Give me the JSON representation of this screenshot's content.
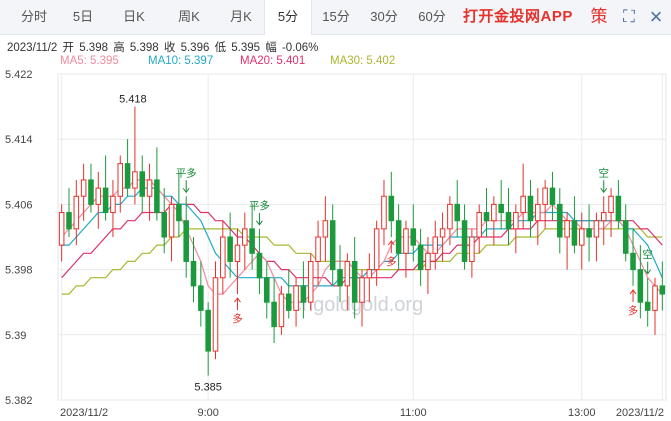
{
  "tabs": [
    {
      "label": "分时"
    },
    {
      "label": "5日"
    },
    {
      "label": "日K"
    },
    {
      "label": "周K"
    },
    {
      "label": "月K"
    },
    {
      "label": "5分"
    },
    {
      "label": "15分"
    },
    {
      "label": "30分"
    },
    {
      "label": "60分"
    }
  ],
  "active_tab": "5分",
  "brand": "打开金投网APP",
  "toolbar": {
    "strategy": "策",
    "fullscreen": "⛶",
    "close": "×"
  },
  "info": {
    "date": "2023/11/2",
    "open_label": "开",
    "open": "5.398",
    "high_label": "高",
    "high": "5.398",
    "close_label": "收",
    "close": "5.396",
    "low_label": "低",
    "low": "5.395",
    "change_label": "幅",
    "change": "-0.06%"
  },
  "ma": [
    {
      "label": "MA5: 5.395",
      "color": "#f08aa0"
    },
    {
      "label": "MA10: 5.397",
      "color": "#22a9c8"
    },
    {
      "label": "MA20: 5.401",
      "color": "#e0306a"
    },
    {
      "label": "MA30: 5.402",
      "color": "#a8b830"
    }
  ],
  "watermark": "cngoldgold.org",
  "colors": {
    "up": "#e5322d",
    "down": "#1a9a3c",
    "signal": "#1a8a3a"
  },
  "chart_data": {
    "type": "candlestick",
    "ylim": [
      5.382,
      5.422
    ],
    "yticks": [
      "5.422",
      "5.414",
      "5.406",
      "5.398",
      "5.39",
      "5.382"
    ],
    "xticks": [
      "2023/11/2",
      "9:00",
      "11:00",
      "13:00",
      "2023/11/2"
    ],
    "extremes": {
      "high": "5.418",
      "low": "5.385"
    },
    "signals": [
      {
        "label": "平多",
        "index": 17,
        "type": "close-long"
      },
      {
        "label": "平多",
        "index": 27,
        "type": "close-long"
      },
      {
        "label": "多",
        "index": 24,
        "type": "long"
      },
      {
        "label": "多",
        "index": 45,
        "type": "long"
      },
      {
        "label": "多",
        "index": 78,
        "type": "long"
      },
      {
        "label": "空",
        "index": 74,
        "type": "short"
      },
      {
        "label": "空",
        "index": 80,
        "type": "short"
      }
    ],
    "ohlc": [
      [
        5.401,
        5.406,
        5.399,
        5.405
      ],
      [
        5.405,
        5.408,
        5.402,
        5.403
      ],
      [
        5.403,
        5.409,
        5.401,
        5.407
      ],
      [
        5.407,
        5.411,
        5.404,
        5.409
      ],
      [
        5.409,
        5.411,
        5.405,
        5.406
      ],
      [
        5.406,
        5.41,
        5.403,
        5.408
      ],
      [
        5.408,
        5.412,
        5.404,
        5.405
      ],
      [
        5.405,
        5.409,
        5.402,
        5.407
      ],
      [
        5.407,
        5.412,
        5.405,
        5.411
      ],
      [
        5.411,
        5.414,
        5.407,
        5.408
      ],
      [
        5.408,
        5.418,
        5.406,
        5.41
      ],
      [
        5.41,
        5.412,
        5.405,
        5.407
      ],
      [
        5.407,
        5.411,
        5.404,
        5.409
      ],
      [
        5.409,
        5.413,
        5.404,
        5.405
      ],
      [
        5.405,
        5.408,
        5.4,
        5.402
      ],
      [
        5.402,
        5.407,
        5.399,
        5.406
      ],
      [
        5.406,
        5.41,
        5.402,
        5.404
      ],
      [
        5.404,
        5.407,
        5.397,
        5.399
      ],
      [
        5.399,
        5.402,
        5.394,
        5.396
      ],
      [
        5.396,
        5.399,
        5.391,
        5.393
      ],
      [
        5.393,
        5.394,
        5.385,
        5.388
      ],
      [
        5.388,
        5.399,
        5.387,
        5.397
      ],
      [
        5.397,
        5.404,
        5.395,
        5.402
      ],
      [
        5.402,
        5.405,
        5.397,
        5.399
      ],
      [
        5.399,
        5.403,
        5.395,
        5.401
      ],
      [
        5.401,
        5.405,
        5.398,
        5.403
      ],
      [
        5.403,
        5.406,
        5.398,
        5.4
      ],
      [
        5.4,
        5.403,
        5.395,
        5.397
      ],
      [
        5.397,
        5.399,
        5.392,
        5.394
      ],
      [
        5.394,
        5.397,
        5.389,
        5.391
      ],
      [
        5.391,
        5.396,
        5.39,
        5.395
      ],
      [
        5.395,
        5.398,
        5.392,
        5.393
      ],
      [
        5.393,
        5.397,
        5.391,
        5.396
      ],
      [
        5.396,
        5.399,
        5.392,
        5.394
      ],
      [
        5.394,
        5.4,
        5.393,
        5.399
      ],
      [
        5.399,
        5.404,
        5.396,
        5.402
      ],
      [
        5.402,
        5.407,
        5.399,
        5.404
      ],
      [
        5.404,
        5.406,
        5.396,
        5.398
      ],
      [
        5.398,
        5.401,
        5.394,
        5.396
      ],
      [
        5.396,
        5.4,
        5.393,
        5.399
      ],
      [
        5.399,
        5.402,
        5.392,
        5.394
      ],
      [
        5.394,
        5.398,
        5.391,
        5.397
      ],
      [
        5.397,
        5.4,
        5.394,
        5.398
      ],
      [
        5.398,
        5.404,
        5.396,
        5.403
      ],
      [
        5.403,
        5.409,
        5.401,
        5.407
      ],
      [
        5.407,
        5.41,
        5.402,
        5.404
      ],
      [
        5.404,
        5.406,
        5.398,
        5.4
      ],
      [
        5.4,
        5.404,
        5.397,
        5.403
      ],
      [
        5.403,
        5.406,
        5.399,
        5.401
      ],
      [
        5.401,
        5.403,
        5.396,
        5.398
      ],
      [
        5.398,
        5.402,
        5.395,
        5.4
      ],
      [
        5.4,
        5.404,
        5.398,
        5.402
      ],
      [
        5.402,
        5.405,
        5.399,
        5.403
      ],
      [
        5.403,
        5.407,
        5.401,
        5.406
      ],
      [
        5.406,
        5.409,
        5.402,
        5.404
      ],
      [
        5.404,
        5.406,
        5.398,
        5.399
      ],
      [
        5.399,
        5.403,
        5.397,
        5.402
      ],
      [
        5.402,
        5.406,
        5.4,
        5.405
      ],
      [
        5.405,
        5.408,
        5.402,
        5.404
      ],
      [
        5.404,
        5.407,
        5.401,
        5.406
      ],
      [
        5.406,
        5.409,
        5.403,
        5.405
      ],
      [
        5.405,
        5.408,
        5.401,
        5.403
      ],
      [
        5.403,
        5.406,
        5.4,
        5.405
      ],
      [
        5.405,
        5.411,
        5.403,
        5.407
      ],
      [
        5.407,
        5.409,
        5.402,
        5.404
      ],
      [
        5.404,
        5.408,
        5.401,
        5.406
      ],
      [
        5.406,
        5.409,
        5.403,
        5.408
      ],
      [
        5.408,
        5.41,
        5.404,
        5.406
      ],
      [
        5.406,
        5.408,
        5.4,
        5.402
      ],
      [
        5.402,
        5.405,
        5.398,
        5.404
      ],
      [
        5.404,
        5.407,
        5.4,
        5.401
      ],
      [
        5.401,
        5.405,
        5.398,
        5.403
      ],
      [
        5.403,
        5.406,
        5.399,
        5.402
      ],
      [
        5.402,
        5.405,
        5.399,
        5.404
      ],
      [
        5.404,
        5.407,
        5.401,
        5.405
      ],
      [
        5.405,
        5.408,
        5.402,
        5.407
      ],
      [
        5.407,
        5.409,
        5.403,
        5.404
      ],
      [
        5.404,
        5.406,
        5.399,
        5.4
      ],
      [
        5.4,
        5.403,
        5.396,
        5.398
      ],
      [
        5.398,
        5.401,
        5.392,
        5.394
      ],
      [
        5.394,
        5.397,
        5.391,
        5.393
      ],
      [
        5.393,
        5.397,
        5.39,
        5.396
      ],
      [
        5.396,
        5.399,
        5.393,
        5.395
      ]
    ],
    "ma5": [
      5.402,
      5.403,
      5.404,
      5.405,
      5.406,
      5.407,
      5.407,
      5.407,
      5.408,
      5.408,
      5.409,
      5.409,
      5.409,
      5.408,
      5.407,
      5.406,
      5.405,
      5.403,
      5.401,
      5.399,
      5.396,
      5.395,
      5.395,
      5.396,
      5.397,
      5.398,
      5.399,
      5.4,
      5.399,
      5.397,
      5.395,
      5.394,
      5.394,
      5.394,
      5.395,
      5.396,
      5.398,
      5.399,
      5.399,
      5.399,
      5.398,
      5.397,
      5.397,
      5.398,
      5.399,
      5.401,
      5.402,
      5.402,
      5.402,
      5.401,
      5.4,
      5.4,
      5.401,
      5.402,
      5.403,
      5.403,
      5.403,
      5.403,
      5.404,
      5.404,
      5.404,
      5.404,
      5.404,
      5.405,
      5.405,
      5.405,
      5.405,
      5.406,
      5.405,
      5.404,
      5.404,
      5.403,
      5.403,
      5.403,
      5.403,
      5.404,
      5.404,
      5.403,
      5.401,
      5.399,
      5.397,
      5.396,
      5.395
    ],
    "ma10": [
      5.401,
      5.401,
      5.402,
      5.403,
      5.404,
      5.405,
      5.405,
      5.406,
      5.406,
      5.407,
      5.407,
      5.408,
      5.408,
      5.408,
      5.407,
      5.407,
      5.406,
      5.406,
      5.405,
      5.404,
      5.402,
      5.4,
      5.399,
      5.398,
      5.397,
      5.397,
      5.397,
      5.397,
      5.397,
      5.397,
      5.397,
      5.396,
      5.396,
      5.396,
      5.396,
      5.396,
      5.396,
      5.396,
      5.397,
      5.397,
      5.397,
      5.397,
      5.398,
      5.398,
      5.399,
      5.399,
      5.4,
      5.4,
      5.4,
      5.401,
      5.401,
      5.401,
      5.401,
      5.402,
      5.402,
      5.402,
      5.402,
      5.402,
      5.403,
      5.403,
      5.403,
      5.403,
      5.404,
      5.404,
      5.404,
      5.405,
      5.405,
      5.405,
      5.405,
      5.405,
      5.404,
      5.404,
      5.404,
      5.404,
      5.404,
      5.404,
      5.404,
      5.403,
      5.403,
      5.402,
      5.401,
      5.399,
      5.397
    ],
    "ma20": [
      5.397,
      5.398,
      5.399,
      5.4,
      5.4,
      5.401,
      5.402,
      5.403,
      5.403,
      5.404,
      5.404,
      5.405,
      5.405,
      5.405,
      5.405,
      5.406,
      5.406,
      5.406,
      5.406,
      5.405,
      5.405,
      5.404,
      5.404,
      5.403,
      5.402,
      5.402,
      5.401,
      5.4,
      5.399,
      5.399,
      5.398,
      5.398,
      5.397,
      5.397,
      5.397,
      5.397,
      5.397,
      5.396,
      5.396,
      5.397,
      5.397,
      5.397,
      5.397,
      5.397,
      5.397,
      5.397,
      5.398,
      5.398,
      5.398,
      5.399,
      5.399,
      5.399,
      5.4,
      5.4,
      5.401,
      5.401,
      5.401,
      5.402,
      5.402,
      5.402,
      5.402,
      5.403,
      5.403,
      5.403,
      5.403,
      5.404,
      5.404,
      5.404,
      5.404,
      5.404,
      5.404,
      5.404,
      5.404,
      5.404,
      5.404,
      5.404,
      5.404,
      5.404,
      5.404,
      5.403,
      5.403,
      5.402,
      5.401
    ],
    "ma30": [
      5.395,
      5.395,
      5.396,
      5.396,
      5.397,
      5.397,
      5.397,
      5.398,
      5.398,
      5.399,
      5.399,
      5.4,
      5.4,
      5.401,
      5.401,
      5.402,
      5.402,
      5.403,
      5.403,
      5.403,
      5.403,
      5.403,
      5.403,
      5.403,
      5.403,
      5.402,
      5.402,
      5.402,
      5.402,
      5.401,
      5.401,
      5.401,
      5.4,
      5.4,
      5.4,
      5.399,
      5.399,
      5.399,
      5.399,
      5.399,
      5.398,
      5.398,
      5.398,
      5.398,
      5.398,
      5.398,
      5.398,
      5.398,
      5.398,
      5.398,
      5.399,
      5.399,
      5.399,
      5.399,
      5.4,
      5.4,
      5.4,
      5.4,
      5.401,
      5.401,
      5.401,
      5.401,
      5.402,
      5.402,
      5.402,
      5.402,
      5.403,
      5.403,
      5.403,
      5.403,
      5.403,
      5.403,
      5.403,
      5.403,
      5.403,
      5.403,
      5.403,
      5.403,
      5.403,
      5.403,
      5.402,
      5.402,
      5.402
    ]
  }
}
